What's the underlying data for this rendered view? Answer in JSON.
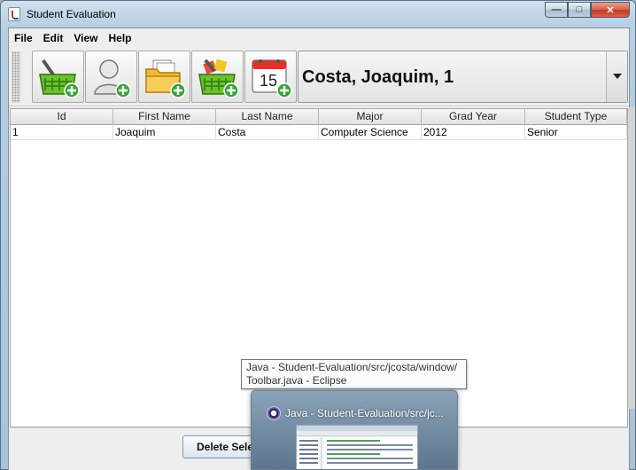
{
  "window": {
    "title": "Student Evaluation"
  },
  "menu": {
    "items": [
      "File",
      "Edit",
      "View",
      "Help"
    ]
  },
  "toolbar": {
    "buttons": [
      {
        "icon": "add-basket-icon"
      },
      {
        "icon": "add-person-icon"
      },
      {
        "icon": "add-folder-icon"
      },
      {
        "icon": "add-items-basket-icon"
      },
      {
        "icon": "add-calendar-icon",
        "calendar_day": "15"
      }
    ],
    "selected_student": "Costa, Joaquim, 1"
  },
  "table": {
    "columns": [
      "Id",
      "First Name",
      "Last Name",
      "Major",
      "Grad Year",
      "Student Type"
    ],
    "rows": [
      [
        "1",
        "Joaquim",
        "Costa",
        "Computer Science",
        "2012",
        "Senior"
      ]
    ]
  },
  "actions": {
    "delete_label": "Delete Selected"
  },
  "taskbar": {
    "tooltip": "Java - Student-Evaluation/src/jcosta/window/ Toolbar.java - Eclipse",
    "tooltip_line1": "Java - Student-Evaluation/src/jcosta/window/",
    "tooltip_line2": "Toolbar.java - Eclipse",
    "preview_title": "Java - Student-Evaluation/src/jc..."
  },
  "colors": {
    "accent_green": "#3aa23a",
    "close_red": "#c2381f"
  }
}
